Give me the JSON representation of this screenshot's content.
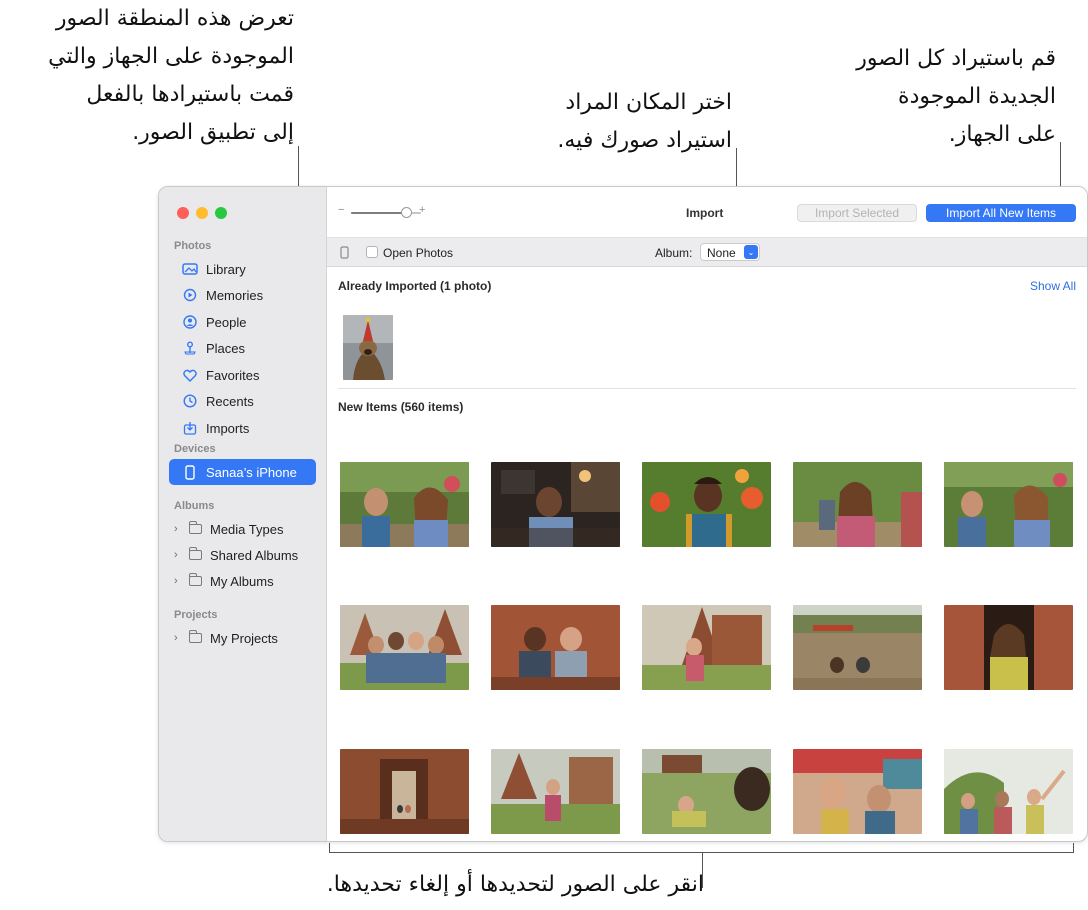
{
  "callouts": {
    "left": [
      "تعرض هذه المنطقة الصور",
      "الموجودة على الجهاز والتي",
      "قمت باستيرادها بالفعل",
      "إلى تطبيق الصور."
    ],
    "middle": [
      "اختر المكان المراد",
      "استيراد صورك فيه."
    ],
    "right": [
      "قم باستيراد كل الصور",
      "الجديدة الموجودة",
      "على الجهاز."
    ],
    "bottom": "انقر على الصور لتحديدها أو إلغاء تحديدها."
  },
  "window": {
    "title": "Import",
    "zoom_minus": "−",
    "zoom_plus": "+",
    "zoom_level": 0.85,
    "import_selected_label": "Import Selected",
    "import_all_label": "Import All New Items",
    "open_photos_label": "Open Photos",
    "album_label": "Album:",
    "album_value": "None",
    "already_imported_header": "Already Imported (1 photo)",
    "show_all_label": "Show All",
    "new_items_header": "New Items (560 items)"
  },
  "sidebar": {
    "photos_title": "Photos",
    "photos_items": [
      {
        "label": "Library",
        "icon": "library-icon"
      },
      {
        "label": "Memories",
        "icon": "memories-icon"
      },
      {
        "label": "People",
        "icon": "people-icon"
      },
      {
        "label": "Places",
        "icon": "places-icon"
      },
      {
        "label": "Favorites",
        "icon": "heart-icon"
      },
      {
        "label": "Recents",
        "icon": "clock-icon"
      },
      {
        "label": "Imports",
        "icon": "imports-icon"
      }
    ],
    "devices_title": "Devices",
    "device_label": "Sanaa’s iPhone",
    "albums_title": "Albums",
    "albums_items": [
      {
        "label": "Media Types"
      },
      {
        "label": "Shared Albums"
      },
      {
        "label": "My Albums"
      }
    ],
    "projects_title": "Projects",
    "projects_items": [
      {
        "label": "My Projects"
      }
    ]
  },
  "colors": {
    "accent": "#3478f6",
    "close": "#ff5f57",
    "minimize": "#febc2e",
    "zoom": "#28c840"
  }
}
